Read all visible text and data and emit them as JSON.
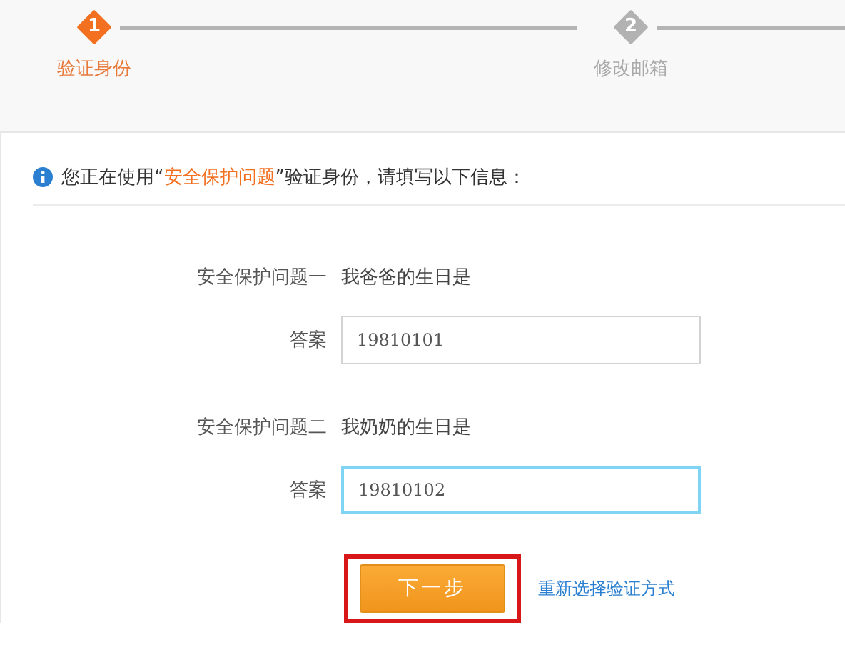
{
  "steps": [
    {
      "number": "1",
      "label": "验证身份",
      "selected": true
    },
    {
      "number": "2",
      "label": "修改邮箱",
      "selected": false
    }
  ],
  "info": {
    "before": "您正在使用“",
    "highlight": "安全保护问题",
    "after": "”验证身份，请填写以下信息："
  },
  "questions": [
    {
      "label": "安全保护问题一",
      "question": "我爸爸的生日是",
      "answer_label": "答案",
      "value": "19810101",
      "focused": false
    },
    {
      "label": "安全保护问题二",
      "question": "我奶奶的生日是",
      "answer_label": "答案",
      "value": "19810102",
      "focused": true
    }
  ],
  "next_button": {
    "label": "下一步",
    "highlighted": true
  },
  "reselect_link": "重新选择验证方式"
}
